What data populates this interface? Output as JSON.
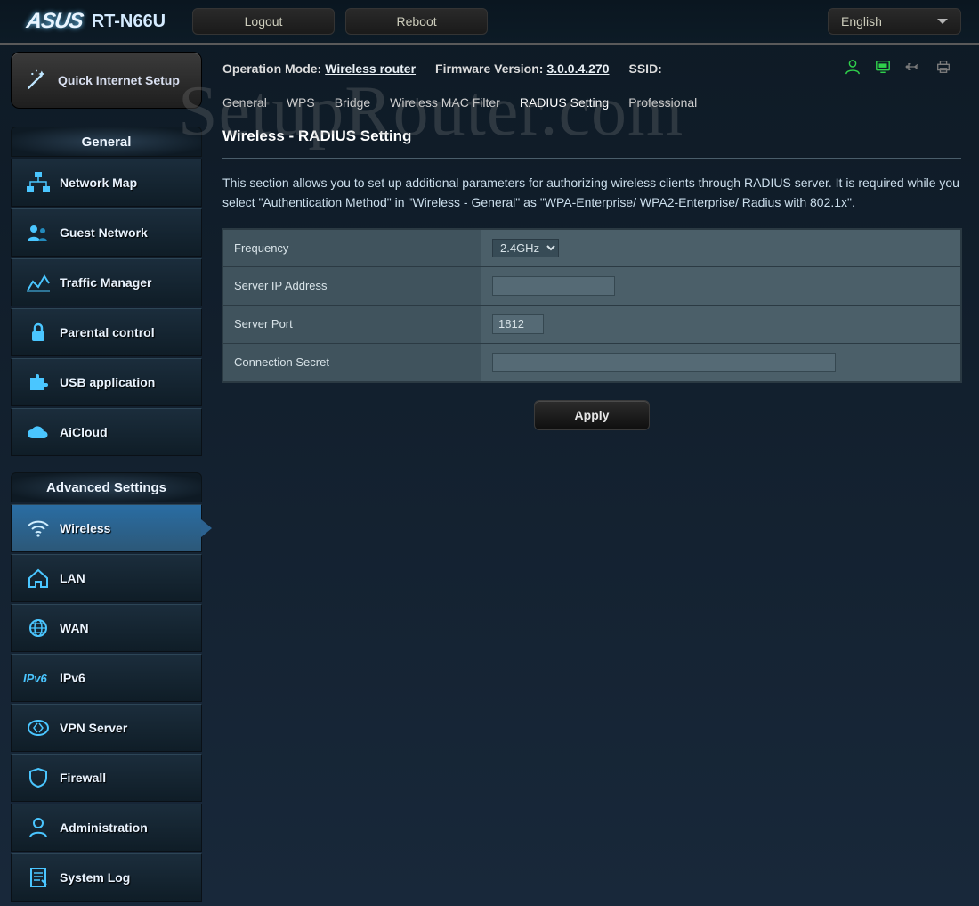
{
  "header": {
    "brand": "ASUS",
    "model": "RT-N66U",
    "logout": "Logout",
    "reboot": "Reboot",
    "language": "English"
  },
  "status": {
    "op_mode_label": "Operation Mode:",
    "op_mode_value": "Wireless router",
    "fw_label": "Firmware Version:",
    "fw_value": "3.0.0.4.270",
    "ssid_label": "SSID:"
  },
  "qis": "Quick Internet Setup",
  "section_general": "General",
  "section_advanced": "Advanced Settings",
  "nav_general": [
    "Network Map",
    "Guest Network",
    "Traffic Manager",
    "Parental control",
    "USB application",
    "AiCloud"
  ],
  "nav_advanced": [
    "Wireless",
    "LAN",
    "WAN",
    "IPv6",
    "VPN Server",
    "Firewall",
    "Administration",
    "System Log"
  ],
  "tabs": [
    "General",
    "WPS",
    "Bridge",
    "Wireless MAC Filter",
    "RADIUS Setting",
    "Professional"
  ],
  "page": {
    "title": "Wireless - RADIUS Setting",
    "desc": "This section allows you to set up additional parameters for authorizing wireless clients through RADIUS server. It is required while you select \"Authentication Method\" in \"Wireless - General\" as \"WPA-Enterprise/ WPA2-Enterprise/ Radius with 802.1x\".",
    "freq_label": "Frequency",
    "freq_value": "2.4GHz",
    "ip_label": "Server IP Address",
    "ip_value": "",
    "port_label": "Server Port",
    "port_value": "1812",
    "secret_label": "Connection Secret",
    "secret_value": "",
    "apply": "Apply"
  },
  "watermark": "SetupRouter.com"
}
